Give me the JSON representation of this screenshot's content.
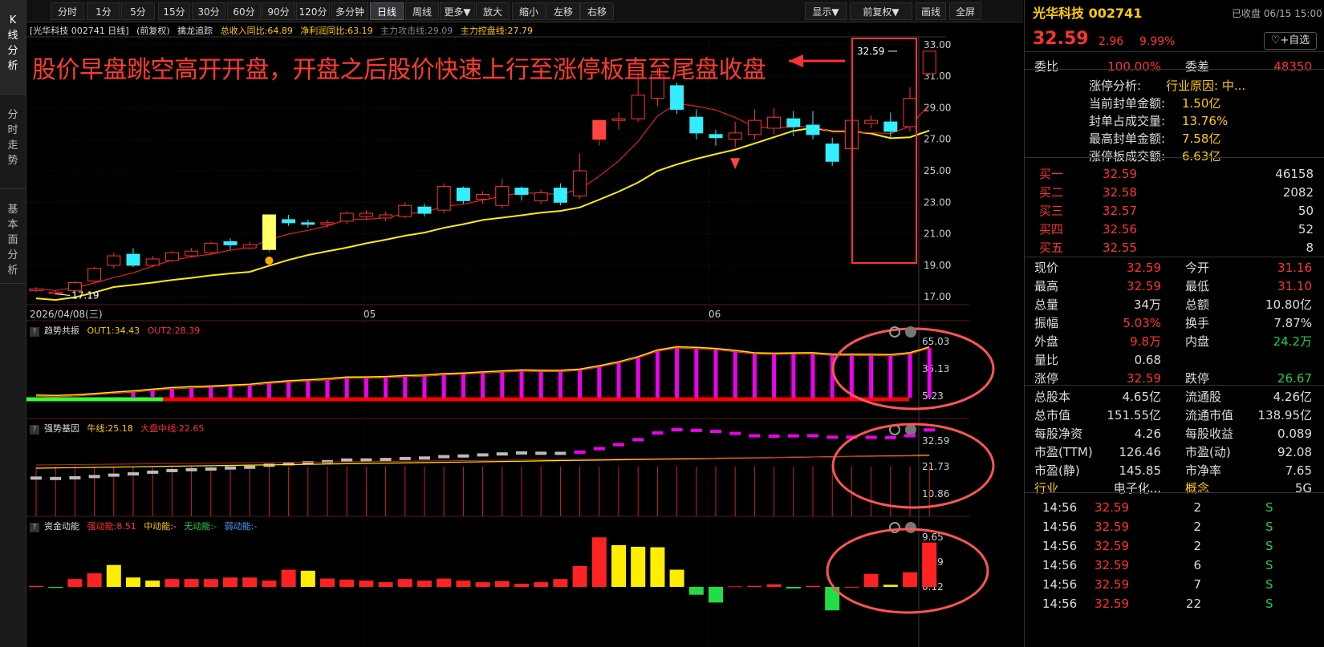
{
  "sidetabs": [
    "K\n线\n分\n析",
    "分\n时\n走\n势",
    "基\n本\n面\n分\n析"
  ],
  "toolbar": {
    "left": [
      "分时",
      "1分",
      "5分",
      "15分",
      "30分",
      "60分",
      "90分",
      "120分",
      "多分钟",
      "日线",
      "周线",
      "更多▼",
      "放大",
      "缩小",
      "左移",
      "右移"
    ],
    "right": [
      "显示▼",
      "前复权▼",
      "画线",
      "全屏"
    ],
    "active": "日线"
  },
  "header": {
    "stock": "[光华科技 002741 日线]",
    "adj": "(前复权)",
    "indicator": "擒龙追踪",
    "items": [
      {
        "t": "总收入同比:64.89",
        "c": "#ffcc00"
      },
      {
        "t": "净利润同比:63.19",
        "c": "#ffcc00"
      },
      {
        "t": "主力攻击线:29.09",
        "c": "#888888"
      },
      {
        "t": "主力控盘线:27.79",
        "c": "#ffcc00"
      }
    ]
  },
  "annotation": "股价早盘跳空高开开盘，开盘之后股价快速上行至涨停板直至尾盘收盘",
  "main": {
    "y_ticks": [
      "33.00",
      "31.00",
      "29.00",
      "27.00",
      "25.00",
      "23.00",
      "21.00",
      "19.00",
      "17.00"
    ],
    "date_label": "2026/04/08(三)",
    "month_labels": [
      "05",
      "06"
    ],
    "low_label": "17.19",
    "last_label": "32.59"
  },
  "panel1": {
    "title": "趋势共振",
    "out1": "OUT1:34.43",
    "out2": "OUT2:28.39",
    "ticks": [
      "65.03",
      "35.13",
      "5.23"
    ]
  },
  "panel2": {
    "title": "强势基因",
    "l1": "牛线:25.18",
    "l2": "大盘中线:22.65",
    "ticks": [
      "32.59",
      "21.73",
      "10.86"
    ]
  },
  "panel3": {
    "title": "资金动能",
    "l1": "强动能:8.51",
    "l2": "中动能:-",
    "l3": "无动能:-",
    "l4": "弱动能:-",
    "ticks": [
      "9.65",
      "4.89",
      "0.12"
    ]
  },
  "chart_data": {
    "type": "candlestick",
    "dates_start": "2026/04/08",
    "ylim": [
      16.5,
      33.5
    ],
    "candles": [
      [
        17.4,
        17.5,
        17.3,
        17.6
      ],
      [
        17.2,
        17.3,
        17.1,
        17.4
      ],
      [
        17.4,
        17.9,
        17.3,
        18.0
      ],
      [
        18.0,
        18.8,
        17.9,
        18.9
      ],
      [
        19.0,
        19.6,
        18.8,
        19.8
      ],
      [
        19.7,
        19.0,
        18.9,
        20.1
      ],
      [
        19.0,
        19.4,
        18.9,
        19.6
      ],
      [
        19.3,
        19.8,
        19.2,
        19.9
      ],
      [
        19.6,
        19.9,
        19.5,
        20.1
      ],
      [
        19.8,
        20.4,
        19.7,
        20.5
      ],
      [
        20.5,
        20.3,
        20.0,
        20.7
      ],
      [
        20.1,
        20.3,
        20.0,
        20.5
      ],
      [
        20.0,
        22.2,
        19.8,
        22.2
      ],
      [
        21.9,
        21.7,
        21.5,
        22.2
      ],
      [
        21.7,
        21.6,
        21.4,
        21.9
      ],
      [
        21.6,
        21.7,
        21.4,
        21.9
      ],
      [
        21.8,
        22.3,
        21.6,
        22.4
      ],
      [
        22.1,
        22.3,
        21.9,
        22.5
      ],
      [
        22.0,
        22.2,
        21.8,
        22.4
      ],
      [
        22.1,
        22.8,
        22.0,
        23.0
      ],
      [
        22.7,
        22.3,
        22.1,
        22.9
      ],
      [
        22.5,
        24.0,
        22.3,
        24.2
      ],
      [
        23.9,
        23.1,
        22.9,
        24.0
      ],
      [
        23.2,
        23.5,
        22.9,
        23.7
      ],
      [
        22.8,
        24.0,
        22.6,
        24.5
      ],
      [
        23.9,
        23.5,
        23.1,
        24.0
      ],
      [
        23.1,
        23.6,
        22.9,
        23.8
      ],
      [
        23.9,
        23.0,
        22.8,
        24.2
      ],
      [
        23.4,
        25.0,
        23.2,
        26.1
      ],
      [
        27.0,
        28.2,
        26.6,
        28.2
      ],
      [
        28.2,
        28.3,
        27.6,
        28.7
      ],
      [
        28.3,
        29.8,
        28.1,
        31.2
      ],
      [
        29.6,
        31.1,
        29.1,
        31.5
      ],
      [
        30.4,
        28.9,
        28.6,
        30.6
      ],
      [
        28.4,
        27.4,
        27.0,
        28.9
      ],
      [
        27.3,
        27.1,
        26.6,
        27.6
      ],
      [
        27.0,
        27.4,
        26.5,
        28.1
      ],
      [
        27.3,
        28.2,
        27.0,
        28.9
      ],
      [
        27.7,
        28.4,
        27.3,
        29.0
      ],
      [
        28.3,
        27.8,
        27.2,
        28.8
      ],
      [
        27.9,
        27.3,
        27.0,
        28.8
      ],
      [
        26.7,
        25.6,
        25.3,
        27.1
      ],
      [
        26.4,
        28.2,
        26.2,
        28.3
      ],
      [
        28.0,
        28.2,
        27.7,
        28.5
      ],
      [
        28.1,
        27.5,
        27.1,
        28.7
      ],
      [
        27.8,
        29.6,
        27.5,
        30.3
      ],
      [
        31.16,
        32.59,
        31.1,
        32.59
      ]
    ]
  }
}
